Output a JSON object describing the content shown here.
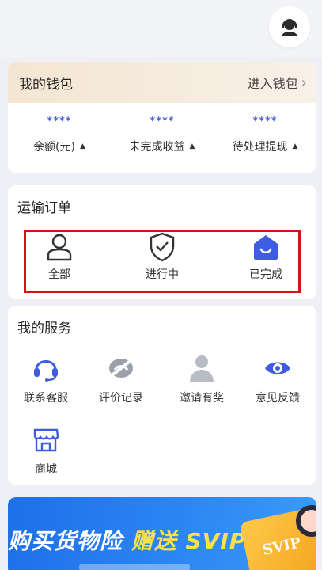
{
  "wallet": {
    "title": "我的钱包",
    "enter_label": "进入钱包",
    "stats": [
      {
        "value": "****",
        "label": "余额(元)"
      },
      {
        "value": "****",
        "label": "未完成收益"
      },
      {
        "value": "****",
        "label": "待处理提现"
      }
    ]
  },
  "orders": {
    "title": "运输订单",
    "items": [
      {
        "label": "全部",
        "icon": "person-icon"
      },
      {
        "label": "进行中",
        "icon": "shield-check-icon"
      },
      {
        "label": "已完成",
        "icon": "home-smile-icon"
      }
    ]
  },
  "services": {
    "title": "我的服务",
    "items": [
      {
        "label": "联系客服",
        "icon": "headset-icon"
      },
      {
        "label": "评价记录",
        "icon": "rating-icon"
      },
      {
        "label": "邀请有奖",
        "icon": "invite-user-icon"
      },
      {
        "label": "意见反馈",
        "icon": "eye-icon"
      },
      {
        "label": "商城",
        "icon": "shop-icon"
      }
    ]
  },
  "banner": {
    "text_main": "购买货物险",
    "text_accent": "赠送 SVIP",
    "badge": "SVIP"
  },
  "colors": {
    "accent": "#4a63d8",
    "highlight_border": "#d41414",
    "wallet_header": "#f4e6d2"
  }
}
